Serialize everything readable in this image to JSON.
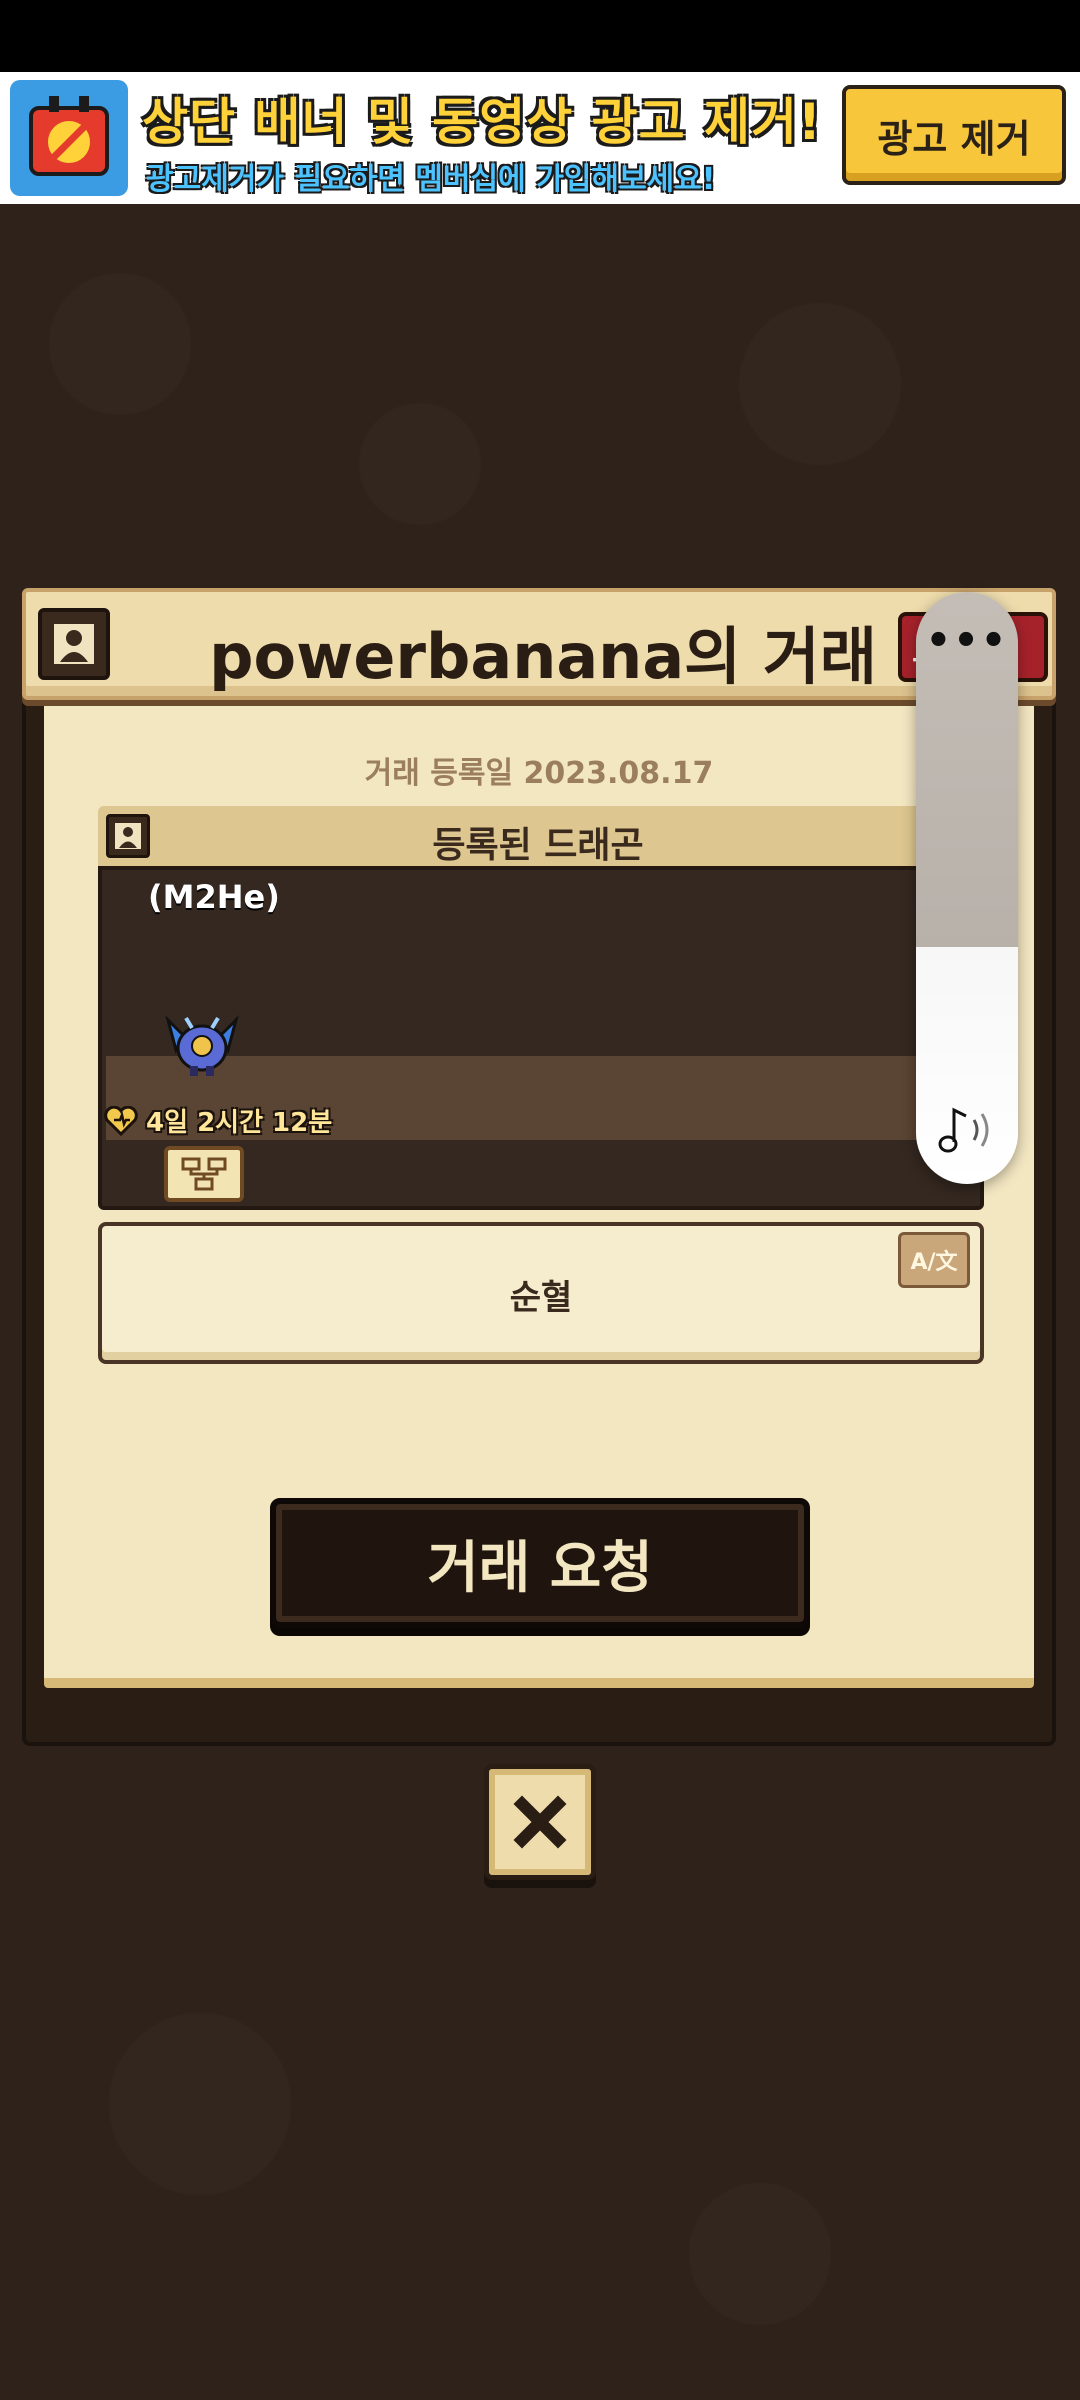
{
  "ad_banner": {
    "title": "상단 배너 및 동영상 광고 제거!",
    "subtitle": "광고제거가 필요하면 멤버십에 가입해보세요!",
    "remove_button": "광고 제거",
    "colors": {
      "title": "#ffd23a",
      "subtitle": "#4cc3ff",
      "button": "#f8c63b"
    }
  },
  "dialog": {
    "title": "powerbanana의 거래",
    "header_button": "보 ⓧ",
    "registration_date": "거래 등록일 2023.08.17",
    "section_title": "등록된 드래곤",
    "dragon": {
      "name": "(M2He)",
      "timer": "4일 2시간 12분",
      "icon": "dragon-sprite"
    },
    "description": "순혈",
    "translate_button": "A/文",
    "trade_button": "거래 요청"
  },
  "close_button": {
    "icon": "close-x-icon"
  },
  "overlay": {
    "menu": "•••",
    "icon": "music-sound-icon"
  },
  "colors": {
    "background": "#2e221b",
    "parchment": "#f3e7c2",
    "header_red": "#a6222b",
    "trade_button": "#1f150e"
  }
}
